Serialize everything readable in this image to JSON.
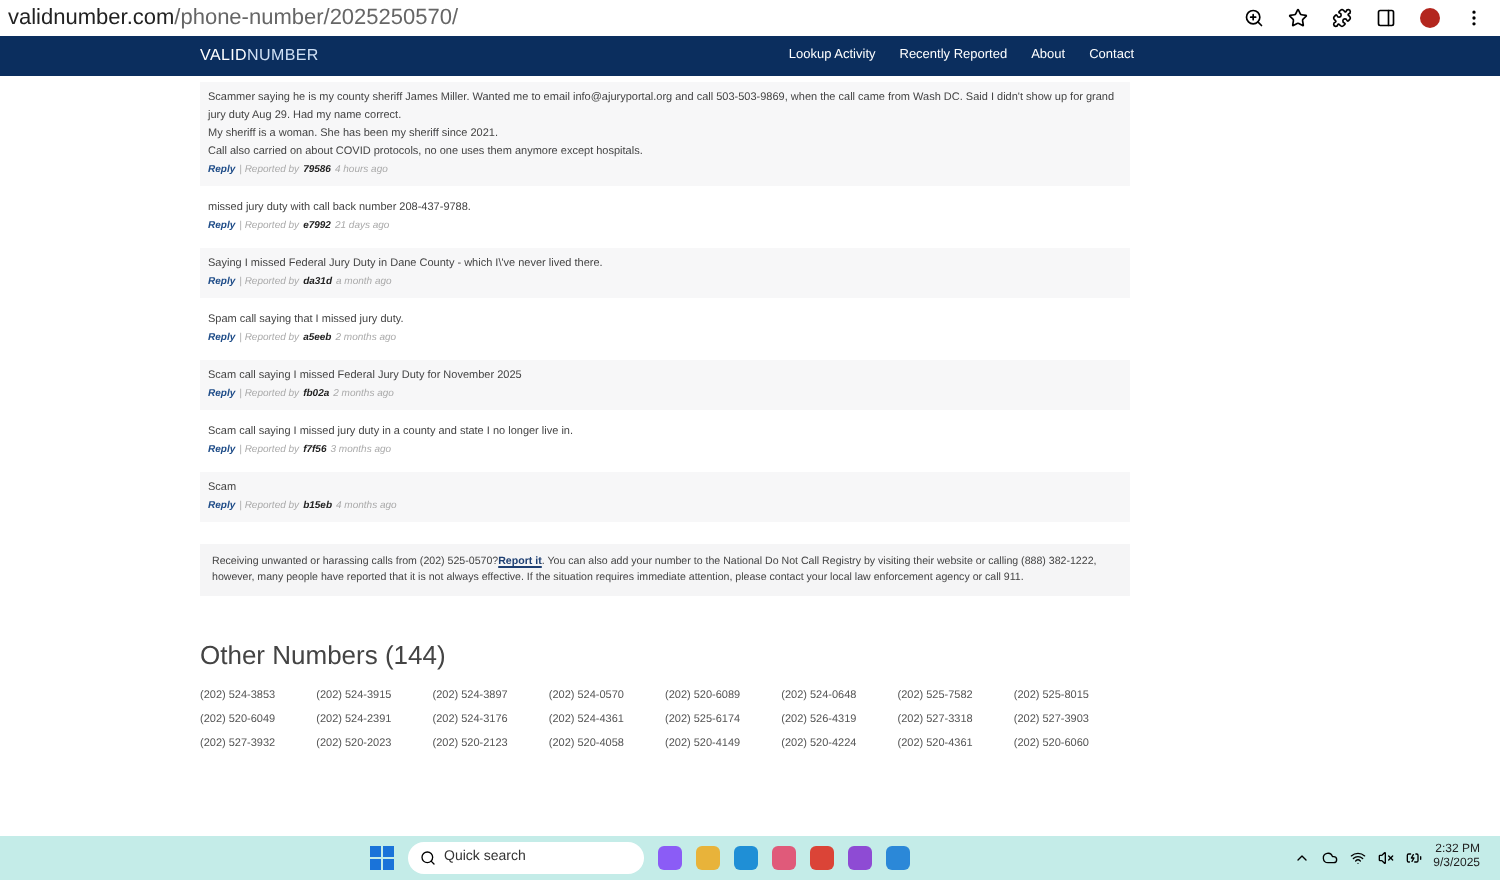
{
  "browser": {
    "url_host": "validnumber.com",
    "url_path": "/phone-number/2025250570/"
  },
  "nav": {
    "logo_left": "VALID",
    "logo_right": "NUMBER",
    "links": [
      "Lookup Activity",
      "Recently Reported",
      "About",
      "Contact"
    ]
  },
  "comments": [
    {
      "lines": [
        "Scammer saying he is my county sheriff James Miller. Wanted me to email info@ajuryportal.org and call 503-503-9869, when the call came from Wash DC. Said I didn't show up for grand jury duty Aug 29. Had my name correct.",
        "My sheriff is a woman. She has been my sheriff since 2021.",
        "Call also carried on about COVID protocols, no one uses them anymore except hospitals."
      ],
      "reply": "Reply",
      "reported_by": "| Reported by",
      "user": "79586",
      "time": "4 hours ago"
    },
    {
      "lines": [
        "missed jury duty with call back number 208-437-9788."
      ],
      "reply": "Reply",
      "reported_by": "| Reported by",
      "user": "e7992",
      "time": "21 days ago"
    },
    {
      "lines": [
        "Saying I missed Federal Jury Duty in Dane County - which I\\'ve never lived there."
      ],
      "reply": "Reply",
      "reported_by": "| Reported by",
      "user": "da31d",
      "time": "a month ago"
    },
    {
      "lines": [
        "Spam call saying that I missed jury duty."
      ],
      "reply": "Reply",
      "reported_by": "| Reported by",
      "user": "a5eeb",
      "time": "2 months ago"
    },
    {
      "lines": [
        "Scam call saying I missed Federal Jury Duty for November 2025"
      ],
      "reply": "Reply",
      "reported_by": "| Reported by",
      "user": "fb02a",
      "time": "2 months ago"
    },
    {
      "lines": [
        "Scam call saying I missed jury duty in a county and state I no longer live in."
      ],
      "reply": "Reply",
      "reported_by": "| Reported by",
      "user": "f7f56",
      "time": "3 months ago"
    },
    {
      "lines": [
        "Scam"
      ],
      "reply": "Reply",
      "reported_by": "| Reported by",
      "user": "b15eb",
      "time": "4 months ago"
    }
  ],
  "notice": {
    "before": "Receiving unwanted or harassing calls from (202) 525-0570?",
    "link": "Report it",
    "after": ". You can also add your number to the National Do Not Call Registry by visiting their website or calling (888) 382-1222, however, many people have reported that it is not always effective. If the situation requires immediate attention, please contact your local law enforcement agency or call 911."
  },
  "other_numbers": {
    "title": "Other Numbers (144)",
    "numbers": [
      "(202) 524-3853",
      "(202) 524-3915",
      "(202) 524-3897",
      "(202) 524-0570",
      "(202) 520-6089",
      "(202) 524-0648",
      "(202) 525-7582",
      "(202) 525-8015",
      "(202) 520-6049",
      "(202) 524-2391",
      "(202) 524-3176",
      "(202) 524-4361",
      "(202) 525-6174",
      "(202) 526-4319",
      "(202) 527-3318",
      "(202) 527-3903",
      "(202) 527-3932",
      "(202) 520-2023",
      "(202) 520-2123",
      "(202) 520-4058",
      "(202) 520-4149",
      "(202) 520-4224",
      "(202) 520-4361",
      "(202) 520-6060"
    ]
  },
  "taskbar": {
    "search": "Quick search",
    "time": "2:32 PM",
    "date": "9/3/2025"
  }
}
